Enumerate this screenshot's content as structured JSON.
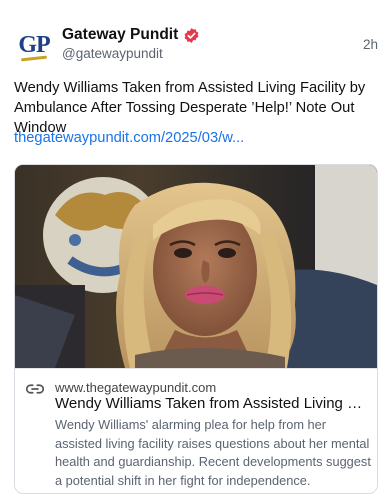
{
  "post": {
    "author": {
      "name": "Gateway Pundit",
      "handle": "@gatewaypundit",
      "avatar_text": "GP"
    },
    "timestamp": "2h",
    "text": "Wendy Williams Taken from Assisted Living Facility by Ambulance After Tossing Desperate ’Help!’ Note Out Window",
    "link_text": "thegatewaypundit.com/2025/03/w..."
  },
  "card": {
    "domain": "www.thegatewaypundit.com",
    "title": "Wendy Williams Taken from Assisted Living Facility by Ambulance After Tossing Desperate ’Help!’ Note Out Window",
    "description": "Wendy Williams' alarming plea for help from her assisted living facility raises questions about her mental health and guardianship. Recent developments suggest a potential shift in her fight for independence."
  },
  "colors": {
    "accent": "#1a73e8",
    "verified": "#e8374a",
    "brand": "#1f3f87"
  },
  "icons": {
    "verified": "verified-badge-icon",
    "link": "link-icon"
  }
}
